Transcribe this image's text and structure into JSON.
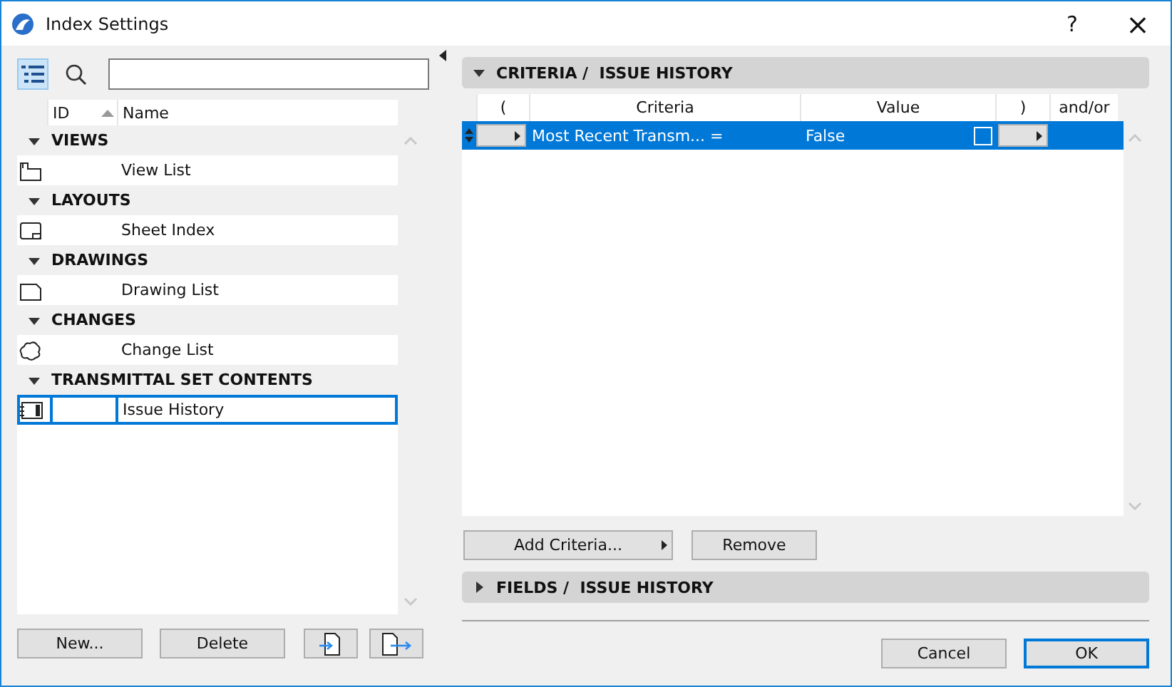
{
  "window": {
    "title": "Index Settings",
    "help": "?",
    "close": "×"
  },
  "left_toolbar": {
    "tree_view_selected": true
  },
  "index_list": {
    "columns": [
      {
        "label": "ID",
        "sorted": true
      },
      {
        "label": "Name",
        "sorted": false
      }
    ],
    "groups": [
      {
        "label": "VIEWS",
        "expanded": true,
        "items": [
          {
            "kind": "view",
            "name": "View List",
            "selected": false
          }
        ]
      },
      {
        "label": "LAYOUTS",
        "expanded": true,
        "items": [
          {
            "kind": "sheet",
            "name": "Sheet Index",
            "selected": false
          }
        ]
      },
      {
        "label": "DRAWINGS",
        "expanded": true,
        "items": [
          {
            "kind": "drawing",
            "name": "Drawing List",
            "selected": false
          }
        ]
      },
      {
        "label": "CHANGES",
        "expanded": true,
        "items": [
          {
            "kind": "change",
            "name": "Change List",
            "selected": false
          }
        ]
      },
      {
        "label": "TRANSMITTAL SET CONTENTS",
        "expanded": true,
        "items": [
          {
            "kind": "transmittal",
            "name": "Issue History",
            "selected": true
          }
        ]
      }
    ]
  },
  "left_buttons": [
    "New...",
    "Delete"
  ],
  "criteria": {
    "title": "CRITERIA /  ISSUE HISTORY",
    "expanded": true,
    "columns": [
      "(",
      "Criteria",
      "Value",
      ")",
      "and/or"
    ],
    "rows": [
      {
        "criteria": "Most Recent Transm... =",
        "value": "False",
        "checked": false,
        "selected": true
      }
    ],
    "buttons": [
      "Add Criteria...",
      "Remove"
    ]
  },
  "fields": {
    "title": "FIELDS /  ISSUE HISTORY",
    "expanded": false
  },
  "dialog_buttons": [
    {
      "label": "Cancel",
      "default": false
    },
    {
      "label": "OK",
      "default": true
    }
  ]
}
